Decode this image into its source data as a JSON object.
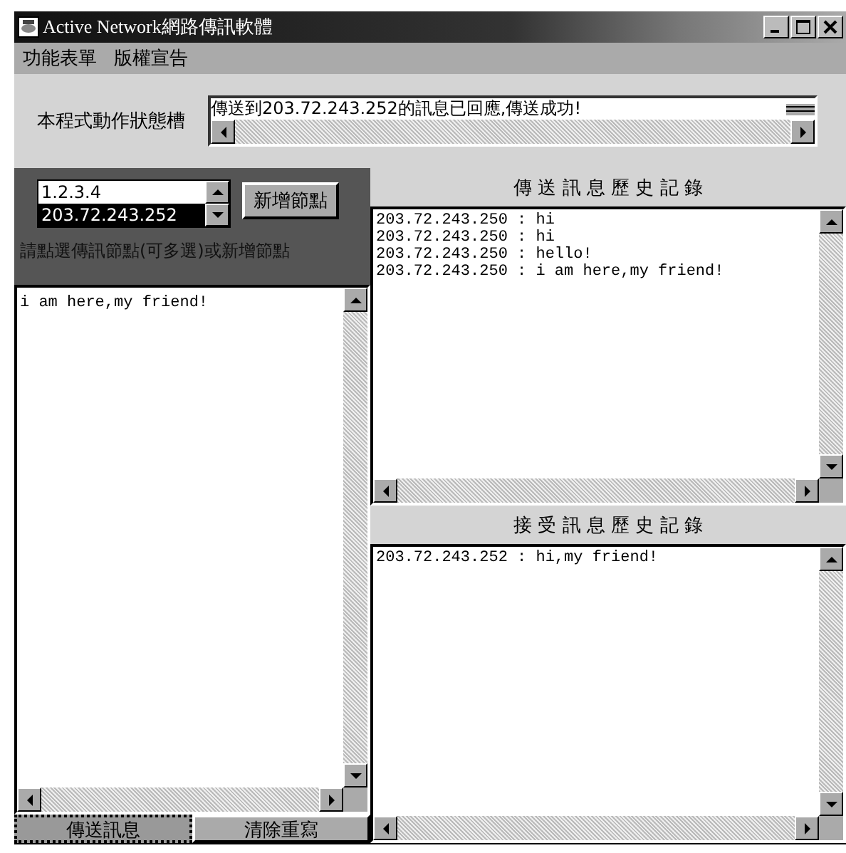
{
  "window": {
    "title": "Active Network網路傳訊軟體"
  },
  "menu": [
    "功能表單",
    "版權宣告"
  ],
  "status": {
    "label": "本程式動作狀態槽",
    "message": "傳送到203.72.243.252的訊息已回應,傳送成功!"
  },
  "nodes": {
    "items": [
      {
        "label": "1.2.3.4",
        "selected": false
      },
      {
        "label": "203.72.243.252",
        "selected": true
      }
    ],
    "add_button": "新增節點",
    "hint": "請點選傳訊節點(可多選)或新增節點"
  },
  "compose": {
    "value": "i am here,my friend!"
  },
  "buttons": [
    {
      "label": "傳送訊息",
      "focused": true
    },
    {
      "label": "清除重寫",
      "focused": false
    }
  ],
  "sent_history": {
    "title": "傳 送 訊 息 歷 史 記 錄",
    "lines": [
      "203.72.243.250 : hi",
      "203.72.243.250 : hi",
      "203.72.243.250 : hello!",
      "203.72.243.250 : i am here,my friend!"
    ]
  },
  "received_history": {
    "title": "接 受 訊 息 歷 史 記 錄",
    "lines": [
      "203.72.243.252 : hi,my friend!"
    ]
  }
}
